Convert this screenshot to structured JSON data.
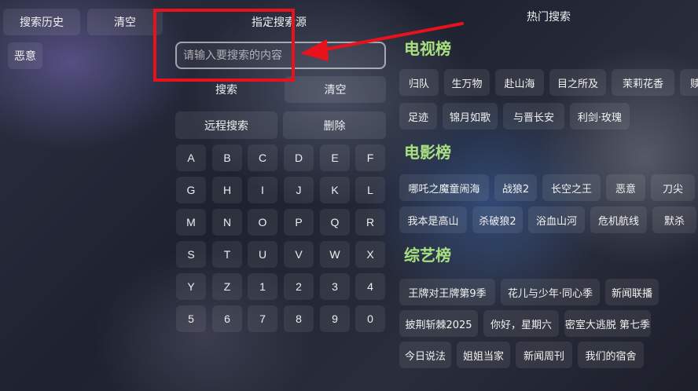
{
  "history": {
    "title": "搜索历史",
    "clear_label": "清空",
    "items": [
      "恶意"
    ]
  },
  "search": {
    "source_label": "指定搜索源",
    "placeholder": "请输入要搜索的内容",
    "value": "",
    "search_label": "搜索",
    "clear_label": "清空",
    "remote_label": "远程搜索",
    "delete_label": "删除"
  },
  "keyboard": {
    "rows": [
      [
        "A",
        "B",
        "C",
        "D",
        "E",
        "F"
      ],
      [
        "G",
        "H",
        "I",
        "J",
        "K",
        "L"
      ],
      [
        "M",
        "N",
        "O",
        "P",
        "Q",
        "R"
      ],
      [
        "S",
        "T",
        "U",
        "V",
        "W",
        "X"
      ],
      [
        "Y",
        "Z",
        "1",
        "2",
        "3",
        "4"
      ],
      [
        "5",
        "6",
        "7",
        "8",
        "9",
        "0"
      ]
    ]
  },
  "hot": {
    "title": "热门搜索",
    "sections": [
      {
        "title": "电视榜",
        "rows": [
          [
            "归队",
            "生万物",
            "赴山海",
            "目之所及",
            "茉莉花香",
            "赎仇"
          ],
          [
            "足迹",
            "锦月如歌",
            "与晋长安",
            "利剑·玫瑰"
          ]
        ]
      },
      {
        "title": "电影榜",
        "rows": [
          [
            "哪吒之魔童闹海",
            "战狼2",
            "长空之王",
            "恶意",
            "刀尖"
          ],
          [
            "我本是高山",
            "杀破狼2",
            "浴血山河",
            "危机航线",
            "默杀"
          ]
        ]
      },
      {
        "title": "综艺榜",
        "rows": [
          [
            "王牌对王牌第9季",
            "花儿与少年·同心季",
            "新闻联播"
          ],
          [
            "披荆斩棘2025",
            "你好，星期六",
            "密室大逃脱 第七季"
          ],
          [
            "今日说法",
            "姐姐当家",
            "新闻周刊",
            "我们的宿舍"
          ]
        ]
      }
    ]
  },
  "annotation": {
    "highlight_color": "#e8121c"
  }
}
